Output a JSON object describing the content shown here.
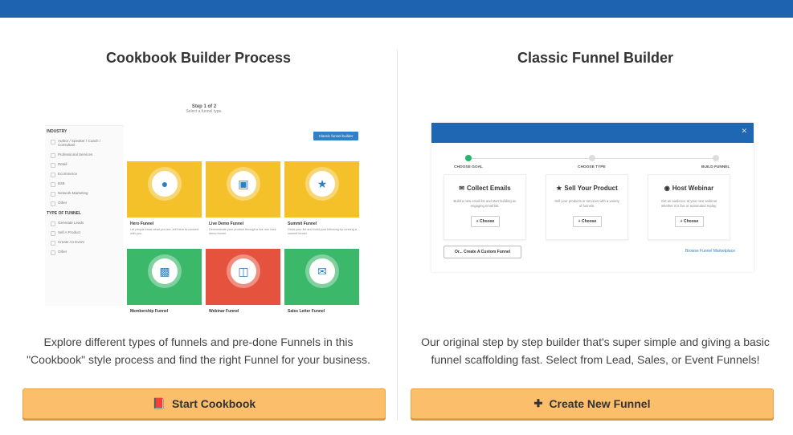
{
  "left": {
    "title": "Cookbook Builder Process",
    "desc_line1": "Explore different types of funnels and pre-done Funnels in this",
    "desc_line2": "\"Cookbook\" style process and find the right Funnel for your business.",
    "button_label": "Start Cookbook",
    "button_icon": "book-icon",
    "preview": {
      "step": "Step 1 of 2",
      "step_sub": "Select a funnel type.",
      "classic_button": "Classic funnel builder",
      "industry_heading": "INDUSTRY",
      "industry_options": [
        "Author / Speaker / Coach / Consultant",
        "Professional Services",
        "Retail",
        "Ecommerce",
        "B2B",
        "Network Marketing",
        "Other"
      ],
      "type_heading": "TYPE OF FUNNEL",
      "type_options": [
        "Generate Leads",
        "Sell A Product",
        "Create An Event",
        "Other"
      ],
      "tiles": [
        {
          "label": "Hero Funnel",
          "sub": "Let people know what you are, tell them to connect with you.",
          "color": "#f5c12a"
        },
        {
          "label": "Live Demo Funnel",
          "sub": "Demonstrate your product through a live one hour demo funnel.",
          "color": "#f5c12a"
        },
        {
          "label": "Summit Funnel",
          "sub": "Grow your list and build your following by running a summit funnel.",
          "color": "#f5c12a"
        },
        {
          "label": "Membership Funnel",
          "sub": "",
          "color": "#3bb86a"
        },
        {
          "label": "Webinar Funnel",
          "sub": "",
          "color": "#e5533e"
        },
        {
          "label": "Sales Letter Funnel",
          "sub": "",
          "color": "#3bb86a"
        }
      ]
    }
  },
  "right": {
    "title": "Classic Funnel Builder",
    "desc_line1": "Our original step by step builder that's super simple and giving a basic",
    "desc_line2": "funnel scaffolding fast. Select from Lead, Sales, or Event Funnels!",
    "button_label": "Create New Funnel",
    "button_icon": "plus-icon",
    "preview": {
      "stages": [
        "CHOOSE GOAL",
        "CHOOSE TYPE",
        "BUILD FUNNEL"
      ],
      "cards": [
        {
          "title": "Collect Emails",
          "desc": "Build a new email list and start building an engaging email list.",
          "choose": "Choose",
          "icon": "email-icon"
        },
        {
          "title": "Sell Your Product",
          "desc": "Sell your products or services with a variety of funnels.",
          "choose": "Choose",
          "icon": "cart-icon"
        },
        {
          "title": "Host Webinar",
          "desc": "Get an audience at your next webinar whether it is live or automated replay.",
          "choose": "Choose",
          "icon": "webinar-icon"
        }
      ],
      "custom_button": "Or... Create A Custom Funnel",
      "browse_link": "Browse Funnel Marketplace"
    }
  },
  "colors": {
    "topbar": "#1e63b0",
    "button": "#fbbf6c",
    "accent_blue": "#2f80c8"
  }
}
